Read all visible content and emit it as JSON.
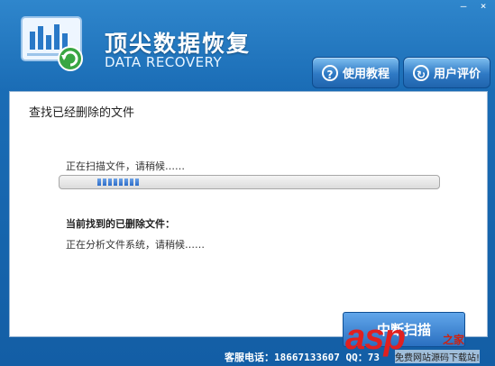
{
  "window": {
    "minimize": "—",
    "close": "×"
  },
  "header": {
    "title_cn": "顶尖数据恢复",
    "title_en": "DATA RECOVERY",
    "buttons": [
      {
        "label": "使用教程",
        "icon": "help-icon"
      },
      {
        "label": "用户评价",
        "icon": "review-icon"
      }
    ]
  },
  "panel": {
    "title": "查找已经删除的文件",
    "scan_status": "正在扫描文件，请稍候……",
    "progress_percent": 20,
    "found_label": "当前找到的已删除文件：",
    "analyze_status": "正在分析文件系统，请稍候……"
  },
  "footer": {
    "stop_button": "中断扫描",
    "service": "客服电话：18667133607  QQ：73"
  },
  "watermark": {
    "brand": "asp",
    "site": "之家",
    "sub": "免费网站源码下载站!"
  }
}
